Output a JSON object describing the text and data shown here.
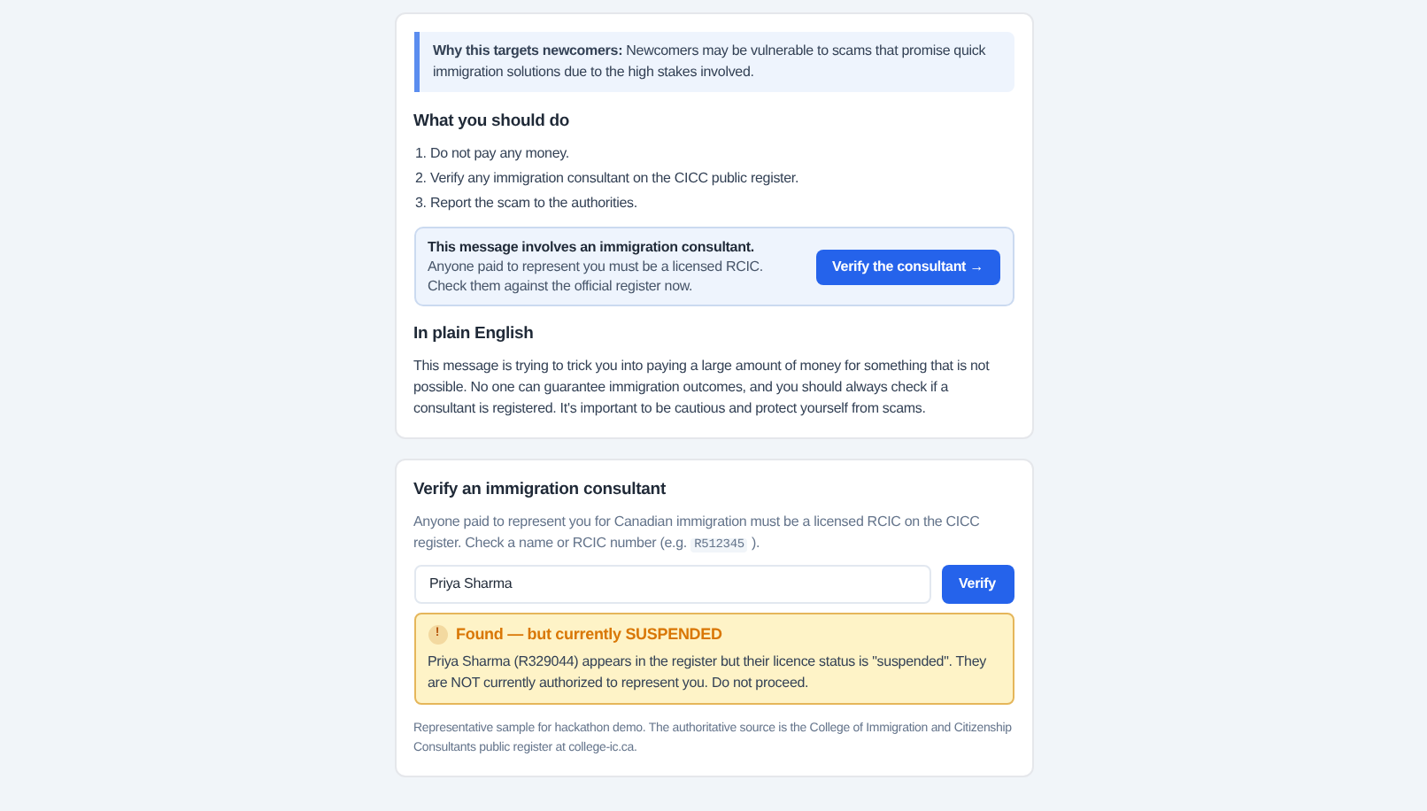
{
  "analysis": {
    "why_note": "**Why this targets newcomers:** Newcomers may be vulnerable to scams that promise quick immigration solutions due to the high stakes involved.",
    "actions_heading": "What you should do",
    "actions": [
      "1. Do not pay any money.",
      "2. Verify any immigration consultant on the CICC public register.",
      "3. Report the scam to the authorities."
    ],
    "consultant_callout": {
      "title": "This message involves an immigration consultant.",
      "text": "Anyone paid to represent you must be a licensed RCIC. Check them against the official register now.",
      "button": "Verify the consultant →"
    },
    "plain_heading": "In plain English",
    "plain_text": "This message is trying to trick you into paying a large amount of money for something that is not possible. No one can guarantee immigration outcomes, and you should always check if a consultant is registered. It's important to be cautious and protect yourself from scams."
  },
  "verify": {
    "heading": "Verify an immigration consultant",
    "hint_before": "Anyone paid to represent you for Canadian immigration must be a licensed RCIC on the CICC register. Check a name or RCIC number (e.g.",
    "hint_code": "R512345",
    "hint_after": ").",
    "search_value": "Priya Sharma",
    "button": "Verify",
    "result": {
      "kind": "suspended",
      "icon": "!",
      "title": "Found — but currently SUSPENDED",
      "text": "Priya Sharma (R329044) appears in the register but their licence status is \"suspended\". They are NOT currently authorized to represent you. Do not proceed."
    },
    "footnote": "Representative sample for hackathon demo. The authoritative source is the College of Immigration and Citizenship Consultants public register at college-ic.ca."
  }
}
